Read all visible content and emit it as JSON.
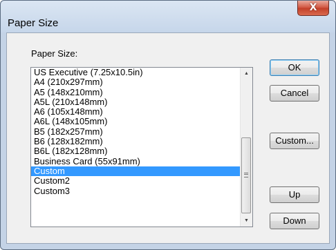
{
  "window": {
    "title": "Paper Size",
    "close_glyph": "X"
  },
  "list": {
    "label": "Paper Size:",
    "items": [
      "US Executive (7.25x10.5in)",
      "A4 (210x297mm)",
      "A5 (148x210mm)",
      "A5L (210x148mm)",
      "A6 (105x148mm)",
      "A6L (148x105mm)",
      "B5 (182x257mm)",
      "B6 (128x182mm)",
      "B6L (182x128mm)",
      "Business Card (55x91mm)",
      "Custom",
      "Custom2",
      "Custom3"
    ],
    "selected": "Custom"
  },
  "buttons": {
    "ok": "OK",
    "cancel": "Cancel",
    "custom": "Custom...",
    "up": "Up",
    "down": "Down"
  },
  "icons": {
    "close": "close-icon",
    "scroll_up": "up-arrow-icon",
    "scroll_down": "down-arrow-icon",
    "thumb_grip": "grip-icon"
  }
}
